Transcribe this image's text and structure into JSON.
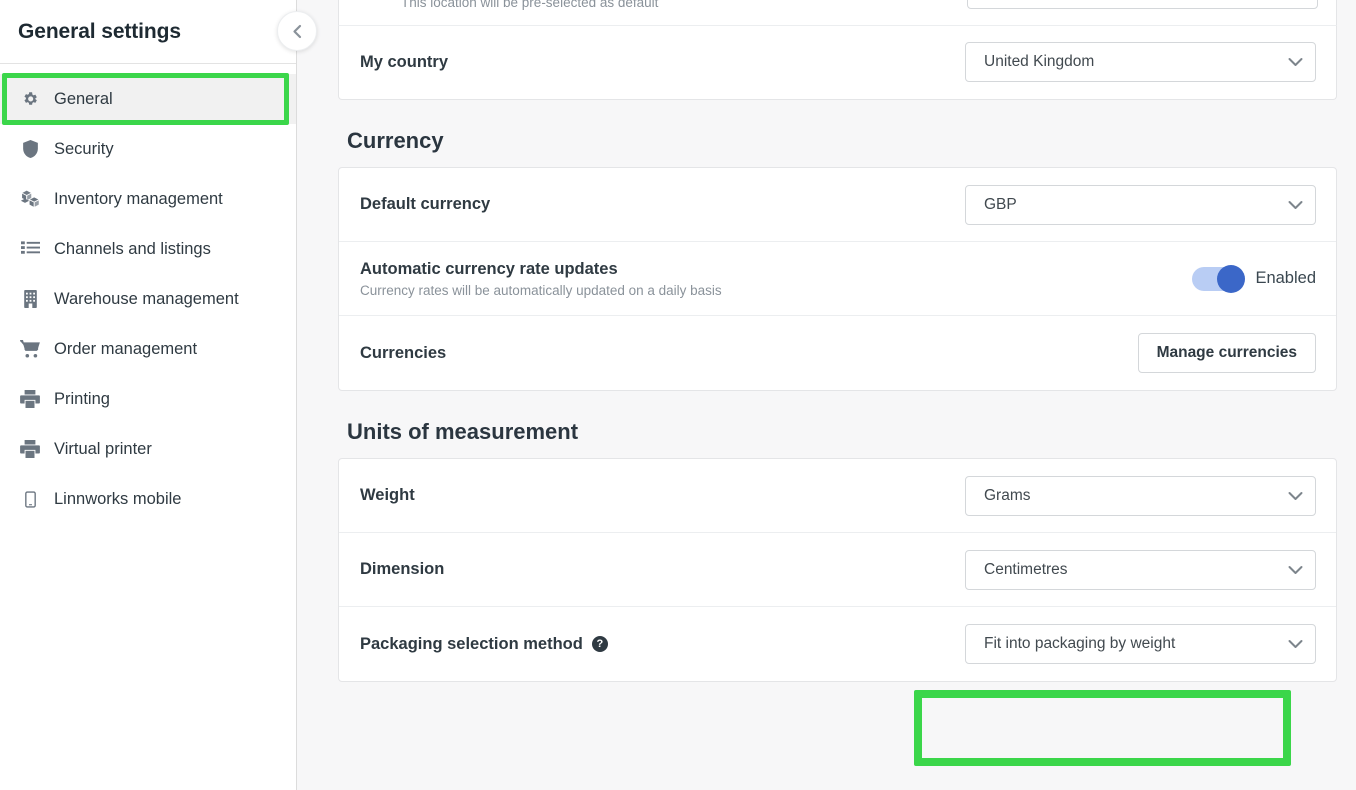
{
  "sidebar": {
    "title": "General settings",
    "collapse_icon": "chevron-left-icon",
    "items": [
      {
        "label": "General",
        "icon": "gear-icon",
        "active": true
      },
      {
        "label": "Security",
        "icon": "shield-icon",
        "active": false
      },
      {
        "label": "Inventory management",
        "icon": "boxes-icon",
        "active": false
      },
      {
        "label": "Channels and listings",
        "icon": "list-icon",
        "active": false
      },
      {
        "label": "Warehouse management",
        "icon": "building-icon",
        "active": false
      },
      {
        "label": "Order management",
        "icon": "cart-icon",
        "active": false
      },
      {
        "label": "Printing",
        "icon": "printer-icon",
        "active": false
      },
      {
        "label": "Virtual printer",
        "icon": "printer-icon",
        "active": false
      },
      {
        "label": "Linnworks mobile",
        "icon": "mobile-icon",
        "active": false
      }
    ]
  },
  "main": {
    "clipped_row": {
      "sub": "This location will be pre-selected as default"
    },
    "country_row": {
      "label": "My country",
      "value": "United Kingdom"
    },
    "currency_section": {
      "title": "Currency",
      "default_currency": {
        "label": "Default currency",
        "value": "GBP"
      },
      "auto_rates": {
        "label": "Automatic currency rate updates",
        "sub": "Currency rates will be automatically updated on a daily basis",
        "state_label": "Enabled",
        "enabled": true
      },
      "currencies": {
        "label": "Currencies",
        "button_label": "Manage currencies"
      }
    },
    "units_section": {
      "title": "Units of measurement",
      "weight": {
        "label": "Weight",
        "value": "Grams"
      },
      "dimension": {
        "label": "Dimension",
        "value": "Centimetres"
      },
      "packaging": {
        "label": "Packaging selection method",
        "help_glyph": "?",
        "value": "Fit into packaging by weight"
      }
    }
  },
  "colors": {
    "highlight": "#3bd64a",
    "toggle_on": "#3b67c8",
    "toggle_track": "#b9cdf4",
    "page_bg": "#f7f7f8",
    "panel_bg": "#ffffff",
    "active_nav_bg": "#f1f1f1"
  }
}
